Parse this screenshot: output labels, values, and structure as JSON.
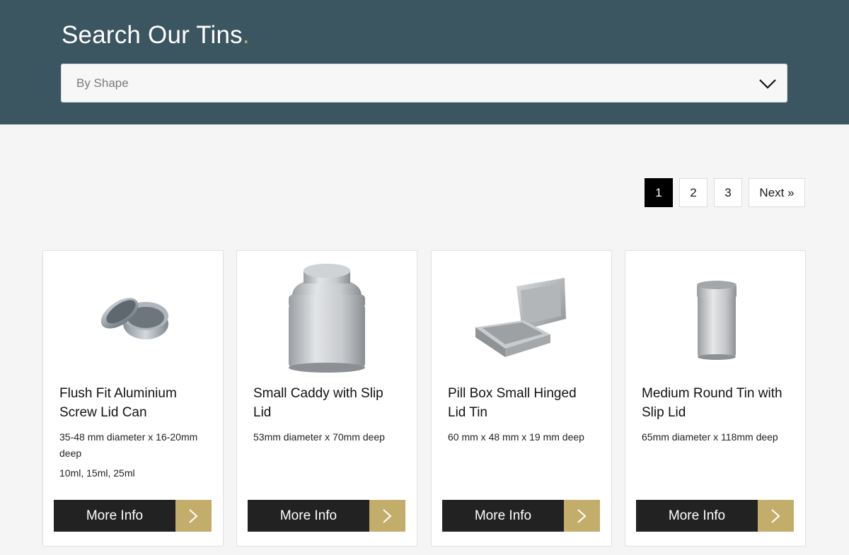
{
  "header": {
    "title": "Search Our Tins",
    "title_dot": ".",
    "filter": {
      "value": "By Shape"
    }
  },
  "pagination": {
    "pages": [
      "1",
      "2",
      "3"
    ],
    "current": "1",
    "next_label": "Next »"
  },
  "products": [
    {
      "title": "Flush Fit Aluminium Screw Lid Can",
      "description": "35-48 mm diameter x 16-20mm deep",
      "sizes": "10ml, 15ml, 25ml",
      "button_label": "More Info"
    },
    {
      "title": "Small Caddy with Slip Lid",
      "description": "53mm diameter x 70mm deep",
      "sizes": "",
      "button_label": "More Info"
    },
    {
      "title": "Pill Box Small Hinged Lid Tin",
      "description": "60 mm x 48 mm x 19 mm deep",
      "sizes": "",
      "button_label": "More Info"
    },
    {
      "title": "Medium Round Tin with Slip Lid",
      "description": "65mm diameter x 118mm deep",
      "sizes": "",
      "button_label": "More Info"
    }
  ],
  "colors": {
    "header_bg": "#3b5561",
    "accent_gold": "#c2ad6b",
    "button_dark": "#222222",
    "page_bg": "#f5f5f5"
  },
  "icons": {
    "select": "chevron-down-icon",
    "button": "chevron-right-icon"
  }
}
